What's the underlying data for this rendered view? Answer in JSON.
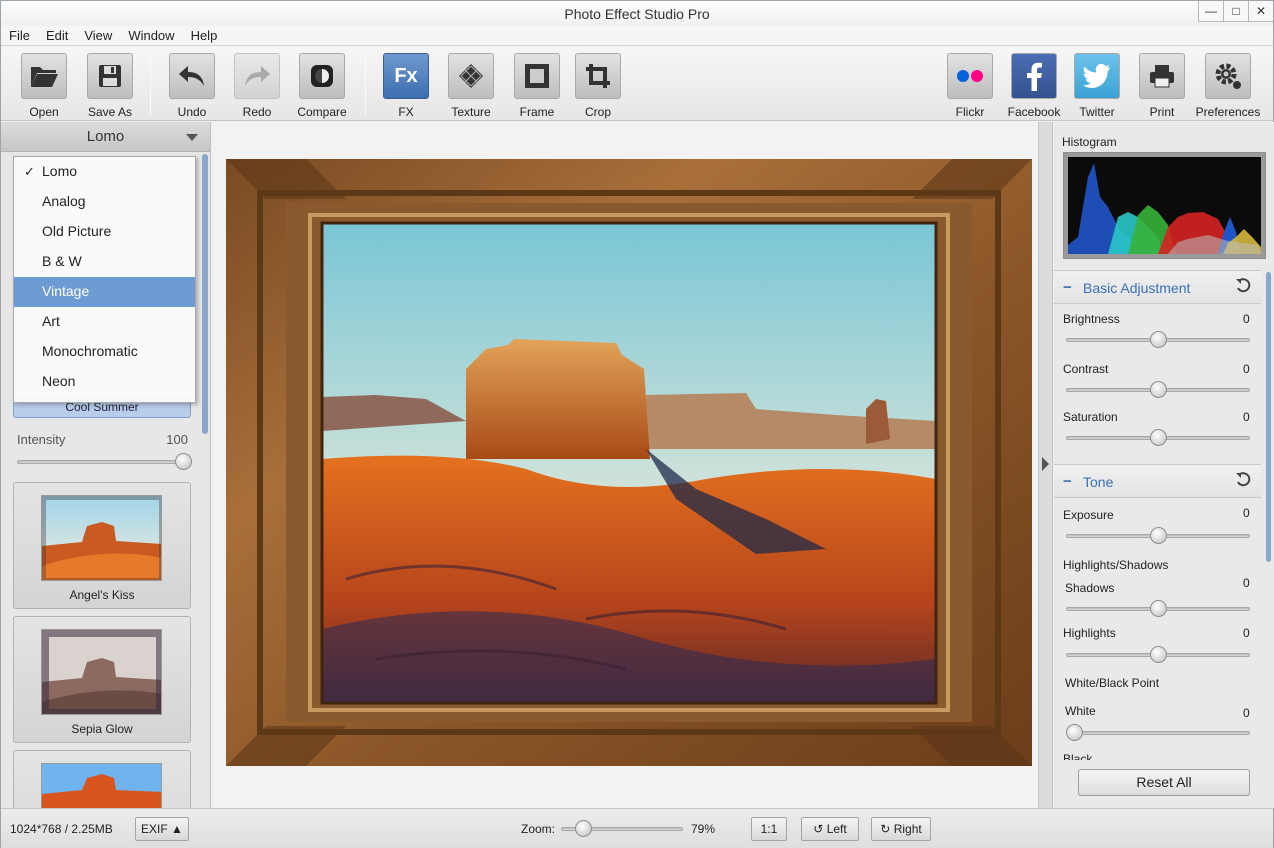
{
  "window": {
    "title": "Photo Effect Studio Pro",
    "controls": [
      "—",
      "□",
      "✕"
    ]
  },
  "menu": [
    "File",
    "Edit",
    "View",
    "Window",
    "Help"
  ],
  "toolbar": {
    "open": "Open",
    "save_as": "Save As",
    "undo": "Undo",
    "redo": "Redo",
    "compare": "Compare",
    "fx": "FX",
    "fx_icon_text": "Fx",
    "texture": "Texture",
    "frame": "Frame",
    "crop": "Crop",
    "flickr": "Flickr",
    "facebook": "Facebook",
    "twitter": "Twitter",
    "print": "Print",
    "preferences": "Preferences"
  },
  "left_panel": {
    "category": "Lomo",
    "dropdown": {
      "items": [
        "Lomo",
        "Analog",
        "Old Picture",
        "B & W",
        "Vintage",
        "Art",
        "Monochromatic",
        "Neon"
      ],
      "checked": "Lomo",
      "highlighted": "Vintage"
    },
    "selected_effect": "Cool Summer",
    "intensity": {
      "label": "Intensity",
      "value": "100",
      "level": 1.0
    },
    "effects": [
      {
        "name": "Angel's Kiss"
      },
      {
        "name": "Sepia Glow"
      },
      {
        "name": ""
      }
    ]
  },
  "right_panel": {
    "histogram_label": "Histogram",
    "basic_adjustment": {
      "title": "Basic Adjustment",
      "brightness": {
        "label": "Brightness",
        "value": "0",
        "level": 0.5
      },
      "contrast": {
        "label": "Contrast",
        "value": "0",
        "level": 0.5
      },
      "saturation": {
        "label": "Saturation",
        "value": "0",
        "level": 0.5
      }
    },
    "tone": {
      "title": "Tone",
      "exposure": {
        "label": "Exposure",
        "value": "0",
        "level": 0.5
      },
      "highlights_shadows_label": "Highlights/Shadows",
      "shadows": {
        "label": "Shadows",
        "value": "0",
        "level": 0.5
      },
      "highlights": {
        "label": "Highlights",
        "value": "0",
        "level": 0.5
      },
      "white_black_label": "White/Black Point",
      "white": {
        "label": "White",
        "value": "0",
        "level": 0.0
      },
      "black_partial": "Black"
    },
    "reset_all": "Reset All"
  },
  "status": {
    "image_info": "1024*768 / 2.25MB",
    "exif": "EXIF ▲",
    "zoom_label": "Zoom:",
    "zoom_value": "79%",
    "zoom_level": 0.13,
    "one_to_one": "1:1",
    "rotate_left": "Left",
    "rotate_right": "Right"
  },
  "colors": {
    "accent": "#3b6fb6",
    "selection": "#6f9bd4",
    "fx_active": "#4a7bbd"
  }
}
